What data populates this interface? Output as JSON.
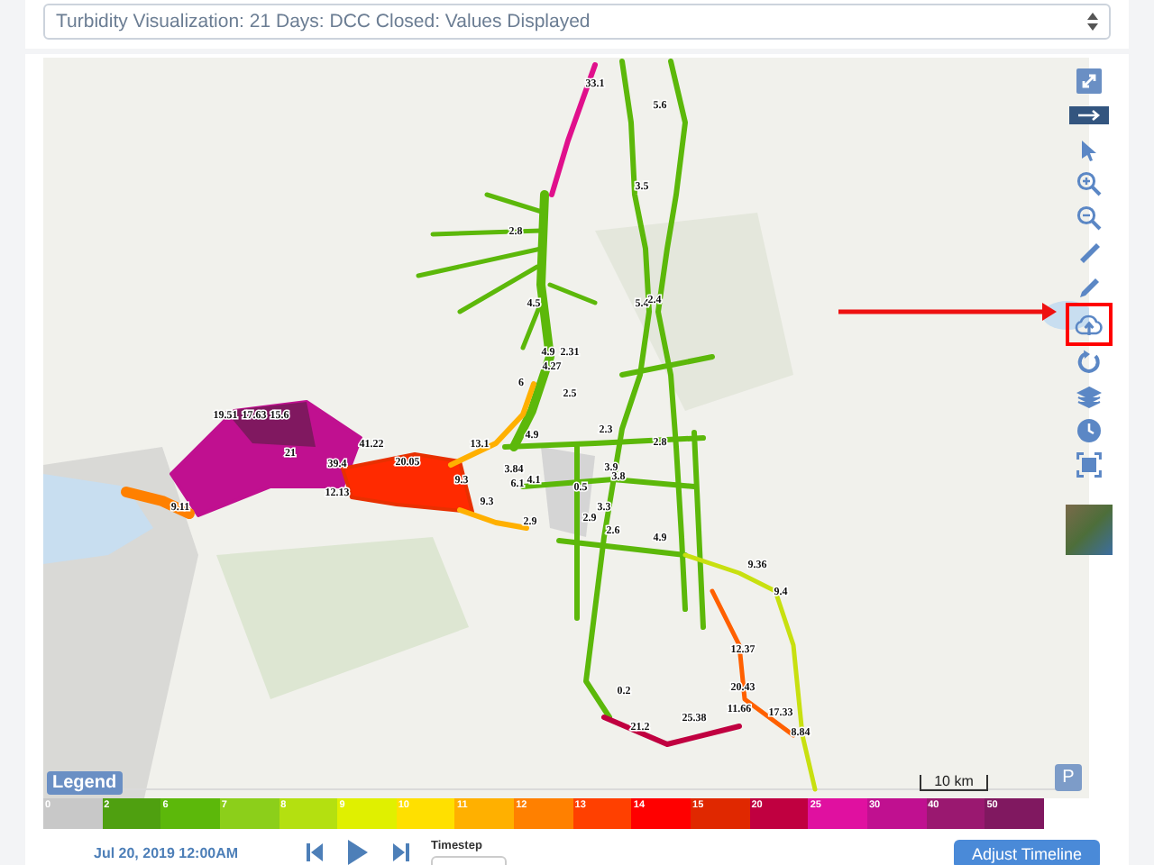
{
  "scenario_select": {
    "value": "Turbidity Visualization: 21 Days: DCC Closed: Values Displayed"
  },
  "map": {
    "value_labels": [
      "33.1",
      "5.6",
      "3.5",
      "2.8",
      "4.5",
      "5.4",
      "2.4",
      "4.9",
      "2.31",
      "4.27",
      "6",
      "2.5",
      "19.51",
      "17.63",
      "15.6",
      "41.22",
      "21",
      "39.4",
      "20.05",
      "13.1",
      "9.3",
      "4.9",
      "2.3",
      "2.8",
      "3.84",
      "4.1",
      "3.9",
      "3.8",
      "6.1",
      "12.13",
      "0.5",
      "9.3",
      "9.11",
      "2.9",
      "2.9",
      "3.3",
      "2.6",
      "4.9",
      "9.36",
      "9.4",
      "12.37",
      "20.43",
      "11.66",
      "17.33",
      "25.38",
      "21.2",
      "8.84",
      "0.2"
    ],
    "toolbar": [
      {
        "kind": "expand",
        "highlighted": false
      },
      {
        "kind": "collapse",
        "highlighted": false
      },
      {
        "kind": "pointer",
        "highlighted": false
      },
      {
        "kind": "zoom-in",
        "highlighted": false
      },
      {
        "kind": "zoom-out",
        "highlighted": false
      },
      {
        "kind": "ruler",
        "highlighted": false
      },
      {
        "kind": "pencil",
        "highlighted": false
      },
      {
        "kind": "cloud-upload",
        "highlighted": true
      },
      {
        "kind": "refresh",
        "highlighted": false
      },
      {
        "kind": "layers",
        "highlighted": false
      },
      {
        "kind": "clock",
        "highlighted": false
      },
      {
        "kind": "fullscreen",
        "highlighted": false
      },
      {
        "kind": "basemap",
        "highlighted": false
      }
    ],
    "legend_button": "Legend",
    "scale": "10 km",
    "panel_button": "P"
  },
  "color_scale": [
    {
      "label": "0",
      "color": "#c8c8c8"
    },
    {
      "label": "2",
      "color": "#4fa010"
    },
    {
      "label": "6",
      "color": "#5cb80a"
    },
    {
      "label": "7",
      "color": "#8ccf1a"
    },
    {
      "label": "8",
      "color": "#b4e010"
    },
    {
      "label": "9",
      "color": "#e0f000"
    },
    {
      "label": "10",
      "color": "#ffe000"
    },
    {
      "label": "11",
      "color": "#ffb000"
    },
    {
      "label": "12",
      "color": "#ff8000"
    },
    {
      "label": "13",
      "color": "#ff4000"
    },
    {
      "label": "14",
      "color": "#ff0000"
    },
    {
      "label": "15",
      "color": "#e02800"
    },
    {
      "label": "20",
      "color": "#c00040"
    },
    {
      "label": "25",
      "color": "#e010a0"
    },
    {
      "label": "30",
      "color": "#c01090"
    },
    {
      "label": "40",
      "color": "#9a1870"
    },
    {
      "label": "50",
      "color": "#801860"
    }
  ],
  "controls": {
    "date": "Jul 20, 2019 12:00AM",
    "timestep_label": "Timestep",
    "adjust_button": "Adjust Timeline"
  }
}
